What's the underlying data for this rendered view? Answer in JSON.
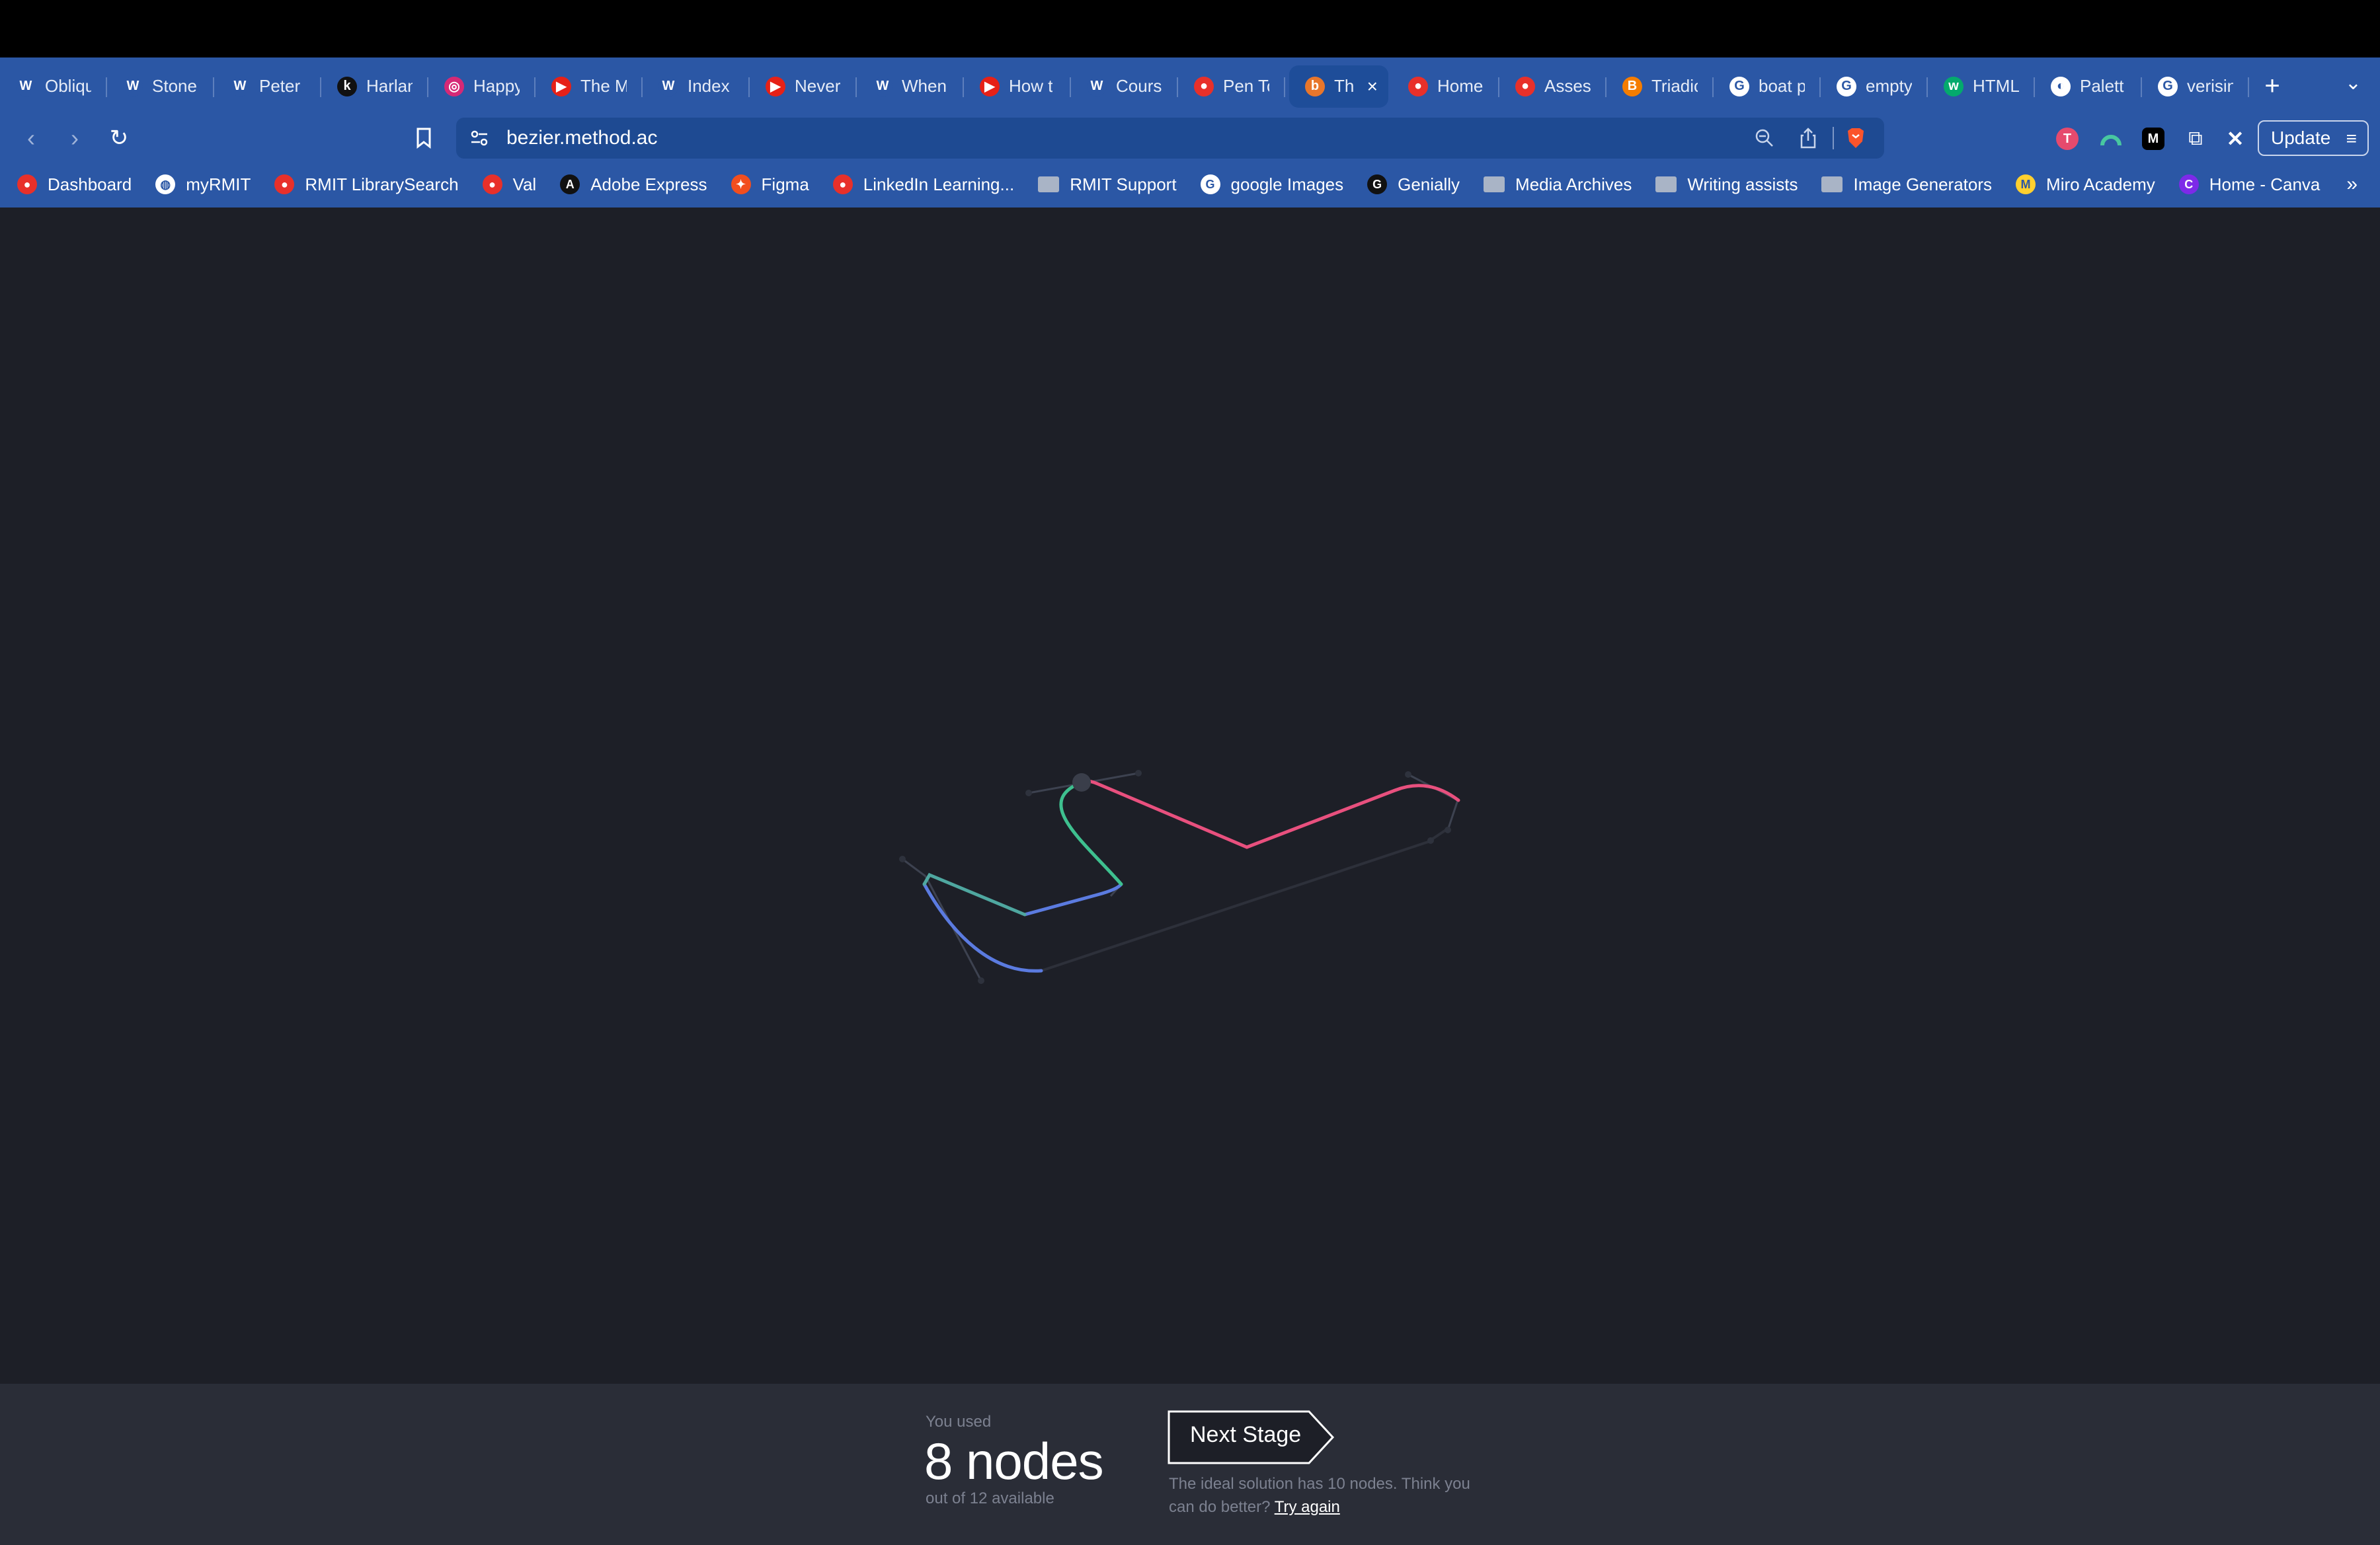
{
  "browser": {
    "tabs": [
      {
        "title": "Obliqu",
        "icon": "wordpress-icon",
        "color": "#2b57a5"
      },
      {
        "title": "Stone",
        "icon": "wordpress-icon",
        "color": "#2b57a5"
      },
      {
        "title": "Peter",
        "icon": "wordpress-icon",
        "color": "#2b57a5"
      },
      {
        "title": "Harlan",
        "icon": "k-icon",
        "color": "#111111"
      },
      {
        "title": "Happy",
        "icon": "instagram-icon",
        "color": "#d62976"
      },
      {
        "title": "The M",
        "icon": "youtube-icon",
        "color": "#e62117"
      },
      {
        "title": "Index",
        "icon": "wordpress-icon",
        "color": "#2b57a5"
      },
      {
        "title": "Never",
        "icon": "youtube-icon",
        "color": "#e62117"
      },
      {
        "title": "When",
        "icon": "wordpress-icon",
        "color": "#2b57a5"
      },
      {
        "title": "How t",
        "icon": "youtube-icon",
        "color": "#e62117"
      },
      {
        "title": "Cours",
        "icon": "wordpress-icon",
        "color": "#2b57a5"
      },
      {
        "title": "Pen To",
        "icon": "rmit-icon",
        "color": "#e8302a"
      },
      {
        "title": "Th",
        "icon": "bezier-icon",
        "color": "#e8762b",
        "active": true
      },
      {
        "title": "Home",
        "icon": "rmit-icon",
        "color": "#e8302a"
      },
      {
        "title": "Asses",
        "icon": "rmit-icon",
        "color": "#e8302a"
      },
      {
        "title": "Triadic",
        "icon": "blogger-icon",
        "color": "#f57d00"
      },
      {
        "title": "boat p",
        "icon": "google-icon",
        "color": "#ffffff"
      },
      {
        "title": "empty",
        "icon": "google-icon",
        "color": "#ffffff"
      },
      {
        "title": "HTML",
        "icon": "w3-icon",
        "color": "#04aa6d"
      },
      {
        "title": "Palett",
        "icon": "palette-icon",
        "color": "#ffffff"
      },
      {
        "title": "verisin",
        "icon": "google-icon",
        "color": "#ffffff"
      }
    ],
    "url": "bezier.method.ac",
    "update_label": "Update",
    "bookmarks": [
      {
        "label": "Dashboard",
        "icon": "rmit-icon",
        "color": "#e8302a"
      },
      {
        "label": "myRMIT",
        "icon": "globe-icon",
        "color": "#ffffff"
      },
      {
        "label": "RMIT LibrarySearch",
        "icon": "rmit-icon",
        "color": "#e8302a"
      },
      {
        "label": "Val",
        "icon": "rmit-icon",
        "color": "#e8302a"
      },
      {
        "label": "Adobe Express",
        "icon": "adobe-icon",
        "color": "#111111"
      },
      {
        "label": "Figma",
        "icon": "figma-icon",
        "color": "#f24e1e"
      },
      {
        "label": "LinkedIn Learning...",
        "icon": "rmit-icon",
        "color": "#e8302a"
      },
      {
        "label": "RMIT Support",
        "icon": "folder-icon",
        "color": "#a9b4c6"
      },
      {
        "label": "google Images",
        "icon": "google-icon",
        "color": "#ffffff"
      },
      {
        "label": "Genially",
        "icon": "genially-icon",
        "color": "#111111"
      },
      {
        "label": "Media Archives",
        "icon": "folder-icon",
        "color": "#a9b4c6"
      },
      {
        "label": "Writing assists",
        "icon": "folder-icon",
        "color": "#a9b4c6"
      },
      {
        "label": "Image Generators",
        "icon": "folder-icon",
        "color": "#a9b4c6"
      },
      {
        "label": "Miro Academy",
        "icon": "miro-icon",
        "color": "#ffd02f"
      },
      {
        "label": "Home - Canva",
        "icon": "canva-icon",
        "color": "#7d2ae8"
      }
    ]
  },
  "game": {
    "used_label": "You used",
    "nodes_count": "8 nodes",
    "out_of_label": "out of 12 available",
    "next_stage_label": "Next Stage",
    "hint_text": "The ideal solution has 10 nodes. Think you can do better?",
    "try_again_label": "Try again",
    "segment_colors": [
      "#5b7be0",
      "#4fa7a0",
      "#3ec08f",
      "#e8507e"
    ]
  }
}
